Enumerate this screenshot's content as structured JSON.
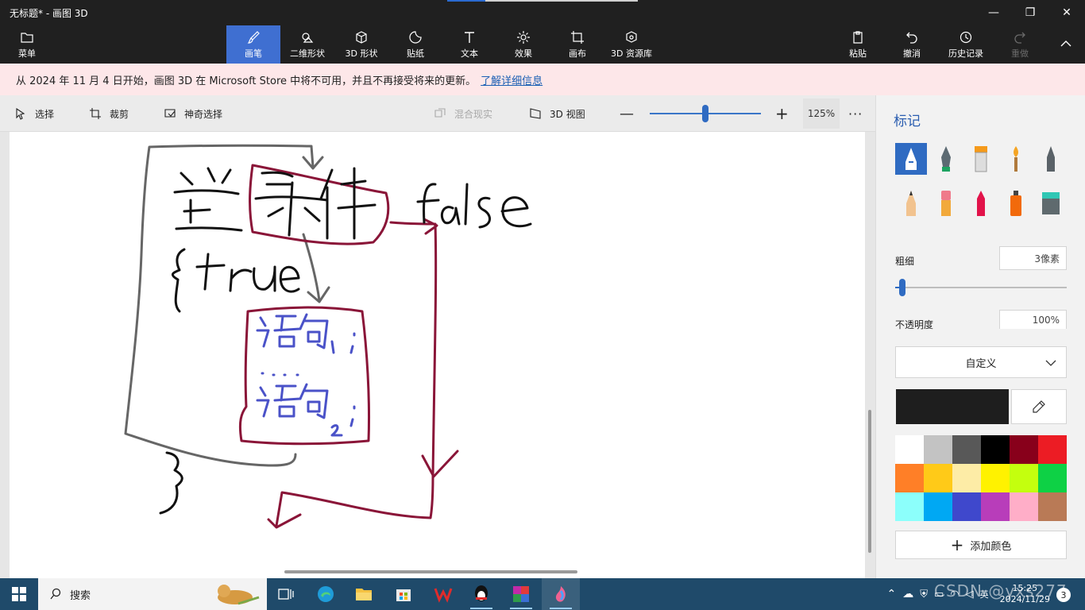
{
  "window": {
    "title": "无标题* - 画图 3D",
    "minimize": "—",
    "maximize": "❐",
    "close": "✕",
    "progress": 0.2
  },
  "ribbon": {
    "menu_label": "菜单",
    "tools": [
      {
        "label": "画笔",
        "icon": "brush-icon",
        "active": true
      },
      {
        "label": "二维形状",
        "icon": "2d-shapes-icon"
      },
      {
        "label": "3D 形状",
        "icon": "3d-shapes-icon"
      },
      {
        "label": "贴纸",
        "icon": "stickers-icon"
      },
      {
        "label": "文本",
        "icon": "text-icon"
      },
      {
        "label": "效果",
        "icon": "effects-icon"
      },
      {
        "label": "画布",
        "icon": "canvas-icon"
      },
      {
        "label": "3D 资源库",
        "icon": "3d-library-icon"
      }
    ],
    "actions": [
      {
        "label": "粘贴",
        "icon": "paste-icon"
      },
      {
        "label": "撤消",
        "icon": "undo-icon"
      },
      {
        "label": "历史记录",
        "icon": "history-icon"
      },
      {
        "label": "重做",
        "icon": "redo-icon",
        "disabled": true
      }
    ]
  },
  "notice": {
    "text": "从 2024 年 11 月 4 日开始，画图 3D 在 Microsoft Store 中将不可用，并且不再接受将来的更新。",
    "link": "了解详细信息"
  },
  "toolbar": {
    "select": "选择",
    "crop": "裁剪",
    "magic_select": "神奇选择",
    "mixed_reality": "混合现实",
    "view_3d": "3D 视图",
    "zoom_value": "125%",
    "zoom_fraction": 0.5,
    "more": "···"
  },
  "canvas": {
    "stroke_colors": {
      "dark": "#111111",
      "gray": "#666666",
      "crimson": "#8a1538",
      "blue": "#4a52c8"
    }
  },
  "panel": {
    "title": "标记",
    "brushes": [
      "marker-icon",
      "calligraphy-pen-icon",
      "oil-brush-icon",
      "watercolor-icon",
      "pixel-pen-icon",
      "pencil-icon",
      "eraser-icon",
      "crayon-icon",
      "spray-can-icon",
      "fill-bucket-icon"
    ],
    "thickness_label": "粗细",
    "thickness_value": "3像素",
    "thickness_fraction": 0.03,
    "opacity_label": "不透明度",
    "opacity_value": "100%",
    "preset": "自定义",
    "current_color": "#1e1e1e",
    "add_color": "添加颜色",
    "palette": [
      "#ffffff",
      "#c3c3c3",
      "#585858",
      "#000000",
      "#88001b",
      "#ec1c24",
      "#ff7f27",
      "#ffca18",
      "#fdeca6",
      "#fff200",
      "#c4ff0e",
      "#0ed145",
      "#8cfffb",
      "#00a8f3",
      "#3f48cc",
      "#b83dba",
      "#ffaec8",
      "#b97a56"
    ]
  },
  "taskbar": {
    "search": "搜索",
    "tray_ime": "英",
    "time": "15:25",
    "date": "2024/11/29",
    "notifications": "3",
    "watermark": "CSDN @yxs277"
  }
}
